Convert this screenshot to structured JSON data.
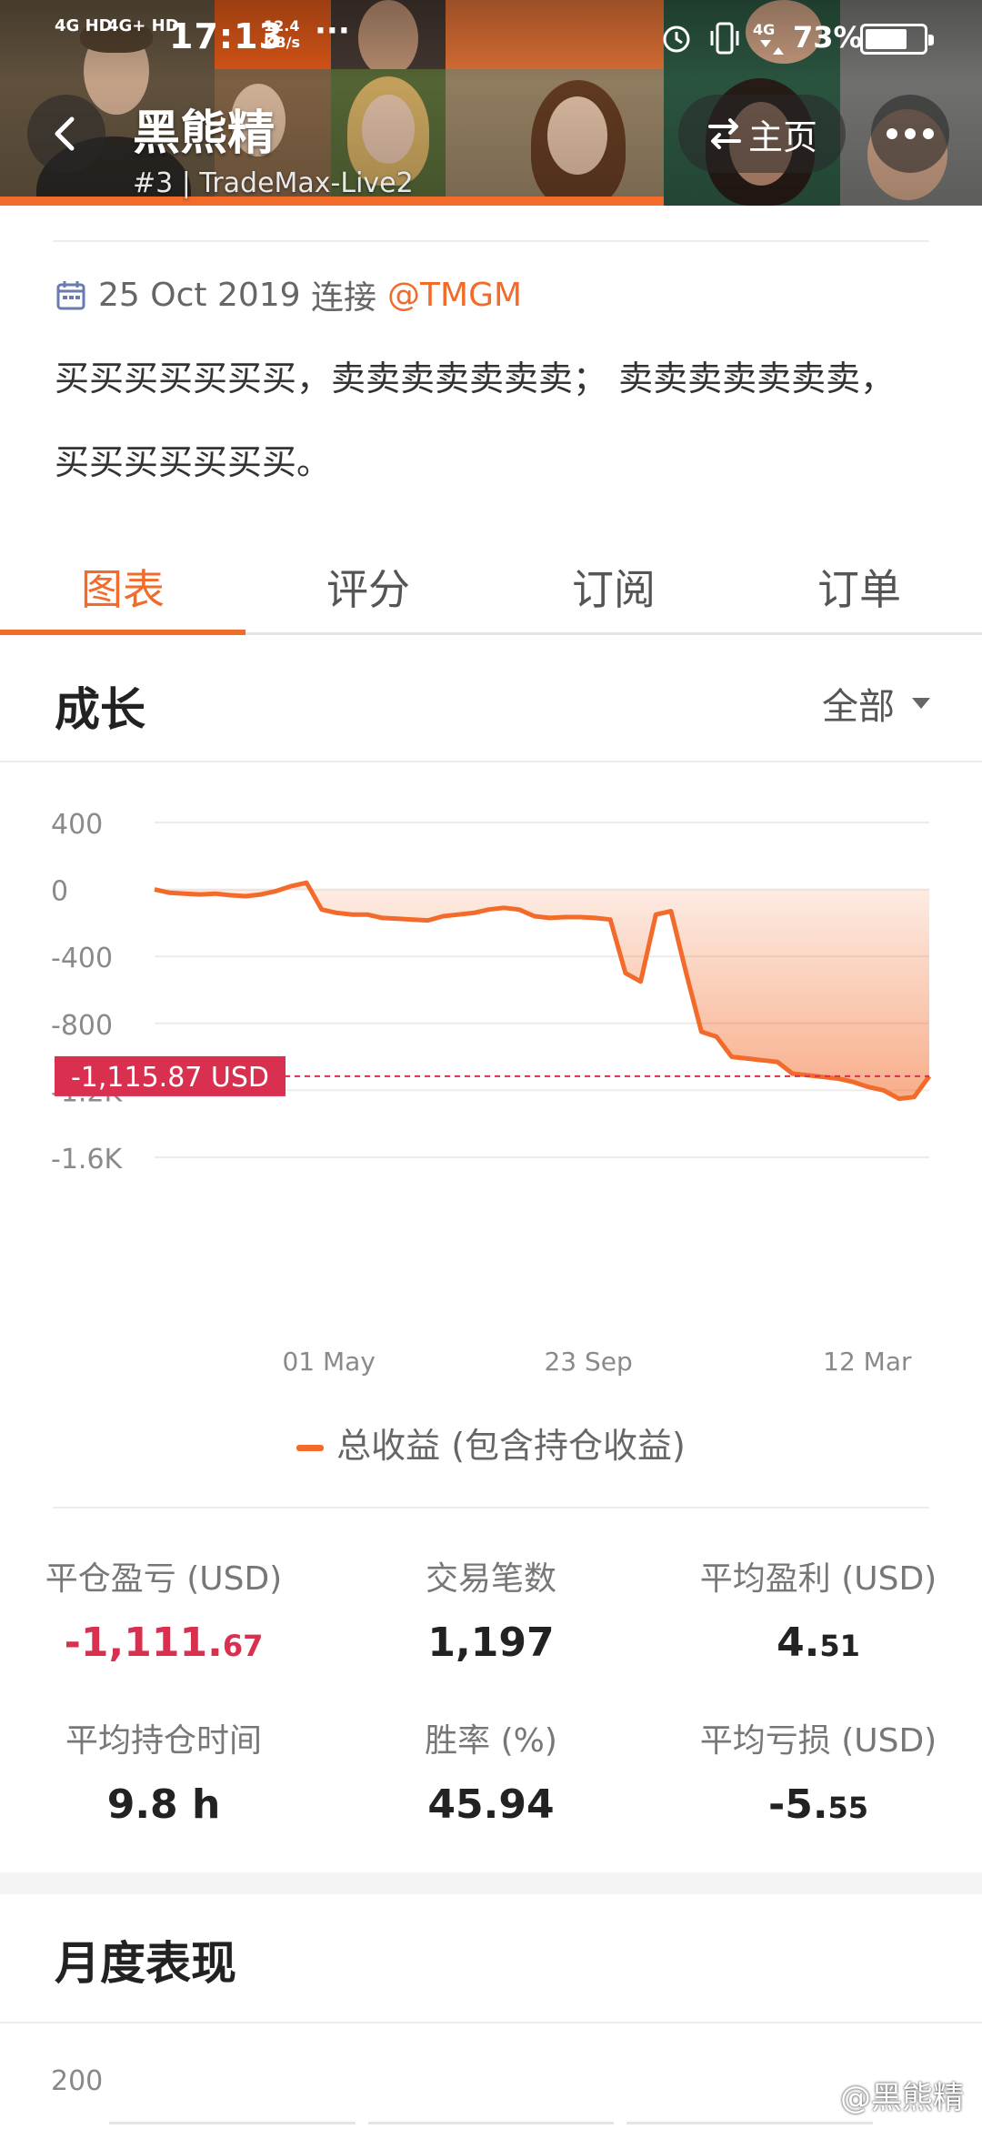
{
  "status_bar": {
    "signal_1": "4G HD",
    "signal_2": "4G+ HD",
    "time": "17:13",
    "speed_value": "12.4",
    "speed_unit": "KB/s",
    "more": "···",
    "battery_text": "73%",
    "battery_level": 0.73
  },
  "header": {
    "title": "黑熊精",
    "subtitle": "#3 | TradeMax-Live2",
    "home_label": "主页",
    "accent_color": "#f26b2a"
  },
  "intro": {
    "date": "25 Oct 2019",
    "connect_text": "连接",
    "mention": "@TMGM",
    "description": "买买买买买买买，卖卖卖卖卖卖卖； 卖卖卖卖卖卖卖，买买买买买买买。"
  },
  "tabs": [
    {
      "label": "图表",
      "active": true
    },
    {
      "label": "评分",
      "active": false
    },
    {
      "label": "订阅",
      "active": false
    },
    {
      "label": "订单",
      "active": false
    }
  ],
  "growth": {
    "title": "成长",
    "range_label": "全部",
    "current_label": "-1,115.87 USD",
    "legend": "总收益 (包含持仓收益)"
  },
  "chart_data": {
    "type": "area",
    "series": [
      {
        "name": "总收益 (包含持仓收益)",
        "color": "#f26b2a",
        "values": [
          0,
          -20,
          -25,
          -30,
          -25,
          -35,
          -40,
          -30,
          -10,
          20,
          40,
          -120,
          -140,
          -150,
          -150,
          -170,
          -175,
          -180,
          -185,
          -160,
          -150,
          -140,
          -120,
          -110,
          -120,
          -160,
          -170,
          -165,
          -165,
          -170,
          -180,
          -500,
          -550,
          -150,
          -130,
          -500,
          -850,
          -880,
          -1000,
          -1010,
          -1020,
          -1030,
          -1100,
          -1110,
          -1120,
          -1130,
          -1150,
          -1180,
          -1200,
          -1250,
          -1240,
          -1115.87
        ]
      }
    ],
    "x_tick_labels": [
      "01 May",
      "23 Sep",
      "12 Mar"
    ],
    "y_tick_labels": [
      "400",
      "0",
      "-400",
      "-800",
      "-1.2K",
      "-1.6K"
    ],
    "ylim": [
      -1600,
      400
    ],
    "current_value": -1115.87,
    "current_value_label": "-1,115.87 USD",
    "grid": true,
    "legend_position": "bottom"
  },
  "stats": {
    "closed_pnl_label": "平仓盈亏 (USD)",
    "closed_pnl_main": "-1,111.",
    "closed_pnl_decimal": "67",
    "trades_label": "交易笔数",
    "trades_value": "1,197",
    "avg_profit_label": "平均盈利 (USD)",
    "avg_profit_main": "4.",
    "avg_profit_decimal": "51",
    "avg_hold_label": "平均持仓时间",
    "avg_hold_value": "9.8 h",
    "win_rate_label": "胜率 (%)",
    "win_rate_value": "45.94",
    "avg_loss_label": "平均亏损 (USD)",
    "avg_loss_main": "-5.",
    "avg_loss_decimal": "55"
  },
  "monthly": {
    "title": "月度表现",
    "axis_top": "200"
  },
  "watermark": "@黑熊精"
}
